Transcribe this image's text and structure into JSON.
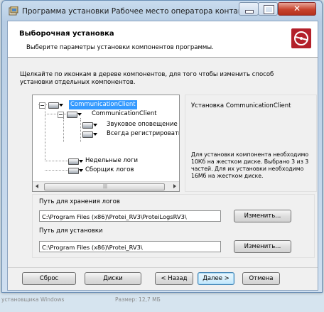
{
  "window": {
    "title": "Программа установки Рабочее место оператора контакт-центра..."
  },
  "header": {
    "title": "Выборочная установка",
    "subtitle": "Выберите параметры установки компонентов программы."
  },
  "instructions": "Щелкайте по иконкам в дереве компонентов, для того чтобы изменить способ установки отдельных компонентов.",
  "tree": {
    "items": [
      {
        "label": "CommunicationClient",
        "selected": true
      },
      {
        "label": "CommunicationClient"
      },
      {
        "label": "Звуковое оповещение"
      },
      {
        "label": "Всегда регистрировать"
      },
      {
        "label": "Недельные логи"
      },
      {
        "label": "Сборщик логов"
      }
    ],
    "scroll_grip": "|||"
  },
  "description": {
    "title": "Установка CommunicationClient",
    "body": "Для установки компонента необходимо 10Кб на жестком диске. Выбрано 3 из 3 частей. Для их установки необходимо 16Мб на жестком диске."
  },
  "paths": {
    "logs_label": "Путь для хранения логов",
    "logs_value": "C:\\Program Files (x86)\\Protei_RV3\\ProteiLogsRV3\\",
    "install_label": "Путь для установки",
    "install_value": "C:\\Program Files (x86)\\Protei_RV3\\",
    "change_label": "Изменить..."
  },
  "buttons": {
    "reset": "Сброс",
    "disks": "Диски",
    "back": "< Назад",
    "next": "Далее >",
    "cancel": "Отмена"
  },
  "status": {
    "left": "установщика Windows",
    "right": "Размер: 12,7 МБ"
  }
}
